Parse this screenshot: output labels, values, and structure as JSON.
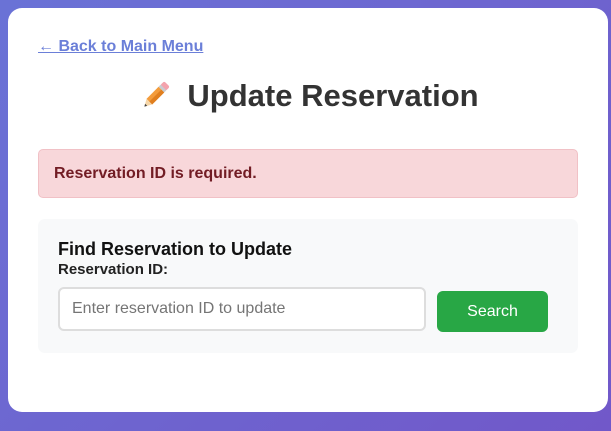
{
  "nav": {
    "back_label": "← Back to Main Menu"
  },
  "header": {
    "icon": "pencil-icon",
    "title": "Update Reservation"
  },
  "alert": {
    "message": "Reservation ID is required.",
    "color": "#721c24",
    "background": "#f8d7da"
  },
  "find_form": {
    "heading": "Find Reservation to Update",
    "field_label": "Reservation ID:",
    "input_value": "",
    "input_placeholder": "Enter reservation ID to update",
    "search_label": "Search",
    "search_color": "#28a745"
  },
  "colors": {
    "link": "#6b7fd8",
    "background_gradient_start": "#6a72d6",
    "background_gradient_end": "#7158c9"
  }
}
